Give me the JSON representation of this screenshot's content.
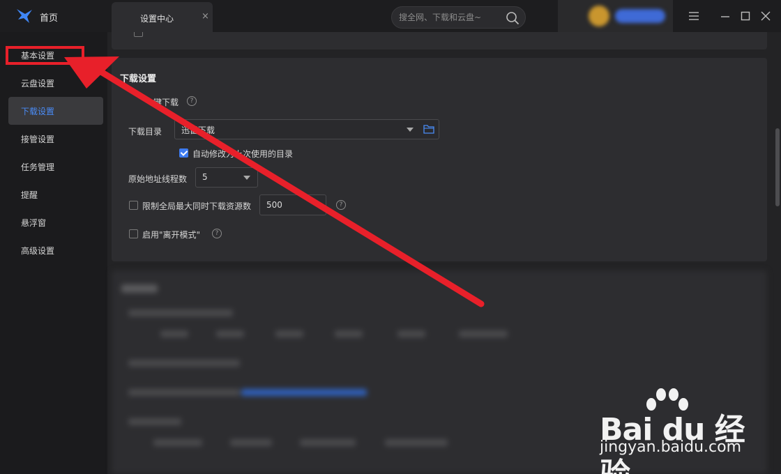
{
  "topbar": {
    "home_label": "首页",
    "tab_label": "设置中心",
    "tab_close": "×",
    "search_placeholder": "搜全网、下载和云盘~"
  },
  "sidebar": {
    "items": [
      {
        "label": "基本设置",
        "active": false
      },
      {
        "label": "云盘设置",
        "active": false
      },
      {
        "label": "下载设置",
        "active": true
      },
      {
        "label": "接管设置",
        "active": false
      },
      {
        "label": "任务管理",
        "active": false
      },
      {
        "label": "提醒",
        "active": false
      },
      {
        "label": "悬浮窗",
        "active": false
      },
      {
        "label": "高级设置",
        "active": false
      }
    ]
  },
  "download_settings": {
    "title": "下载设置",
    "one_click_label": "键下载",
    "help_glyph": "?",
    "dir_label": "下载目录",
    "dir_value": "迅雷下载",
    "auto_modify_label": "自动修改为上次使用的目录",
    "auto_modify_checked": true,
    "threads_label": "原始地址线程数",
    "threads_value": "5",
    "limit_label": "限制全局最大同时下载资源数",
    "limit_checked": false,
    "limit_value": "500",
    "away_mode_label": "启用\"离开模式\"",
    "away_mode_checked": false
  },
  "watermark": {
    "brand": "Bai du 经验",
    "url": "jingyan.baidu.com"
  },
  "colors": {
    "accent": "#3d7bf0",
    "annotation_red": "#e8202a",
    "panel": "#2d2d30",
    "background": "#1b1b1d"
  }
}
